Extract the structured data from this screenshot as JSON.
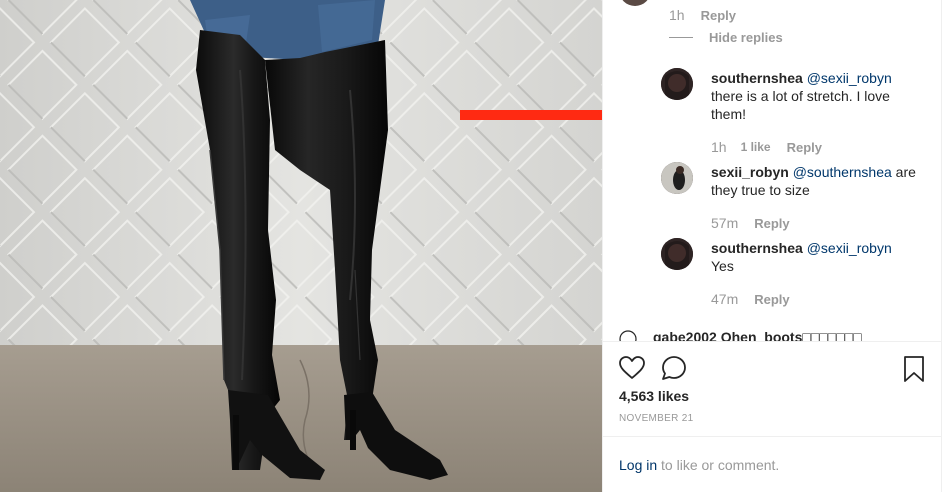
{
  "thread": {
    "top_meta": {
      "time": "1h",
      "reply": "Reply"
    },
    "hide_replies": "Hide replies",
    "comments": [
      {
        "username": "southernshea",
        "mention": "@sexii_robyn",
        "text": "there is a lot of stretch. I love them!",
        "time": "1h",
        "likes": "1 like",
        "reply": "Reply"
      },
      {
        "username": "sexii_robyn",
        "mention": "@southernshea",
        "text": "are they true to size",
        "time": "57m",
        "reply": "Reply"
      },
      {
        "username": "southernshea",
        "mention": "@sexii_robyn",
        "text": "Yes",
        "time": "47m",
        "reply": "Reply"
      }
    ],
    "cutoff_text": "gabe2002 Ohen_boots□□□□□□□"
  },
  "post": {
    "like_count": "4,563 likes",
    "date": "NOVEMBER 21",
    "login_link": "Log in",
    "login_rest": " to like or comment."
  },
  "icons": {
    "like": "heart-icon",
    "comment": "comment-bubble-icon",
    "save": "bookmark-icon",
    "annotation": "red-arrow-icon"
  },
  "colors": {
    "annotation_arrow": "#ff2a12",
    "link": "#003569",
    "mention": "#00376b",
    "muted": "#999999",
    "text": "#262626"
  }
}
